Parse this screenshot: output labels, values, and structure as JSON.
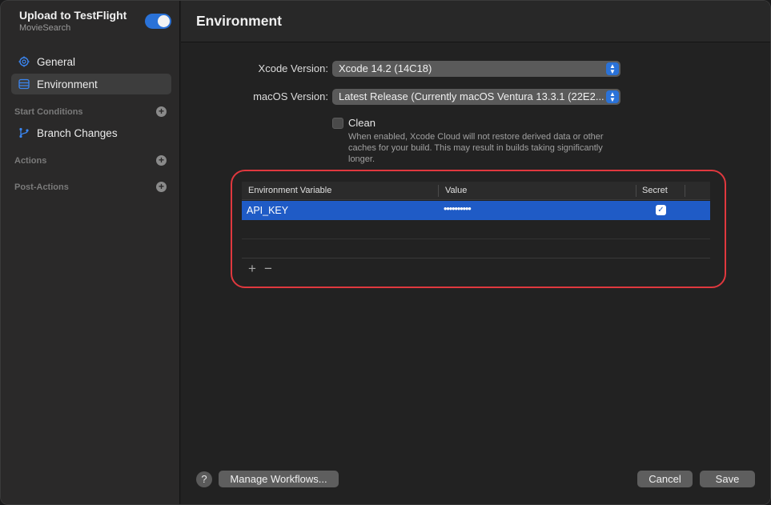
{
  "sidebar": {
    "workflow_title": "Upload to TestFlight",
    "workflow_subtitle": "MovieSearch",
    "toggle_on": true,
    "items": [
      {
        "label": "General",
        "icon": "gear-icon"
      },
      {
        "label": "Environment",
        "icon": "environment-icon",
        "selected": true
      }
    ],
    "start_conditions": {
      "title": "Start Conditions",
      "items": [
        {
          "label": "Branch Changes",
          "icon": "branch-icon"
        }
      ]
    },
    "actions": {
      "title": "Actions"
    },
    "post_actions": {
      "title": "Post-Actions"
    }
  },
  "main": {
    "title": "Environment",
    "xcode_version": {
      "label": "Xcode Version:",
      "value": "Xcode 14.2 (14C18)"
    },
    "macos_version": {
      "label": "macOS Version:",
      "value": "Latest Release (Currently macOS Ventura 13.3.1 (22E2..."
    },
    "clean": {
      "label": "Clean",
      "checked": false,
      "help": "When enabled, Xcode Cloud will not restore derived data or other caches for your build. This may result in builds taking significantly longer."
    },
    "env_table": {
      "columns": [
        "Environment Variable",
        "Value",
        "Secret"
      ],
      "rows": [
        {
          "name": "API_KEY",
          "value": "••••••••••",
          "secret": true
        }
      ],
      "add_label": "+",
      "remove_label": "−"
    }
  },
  "footer": {
    "help_label": "?",
    "manage_workflows": "Manage Workflows...",
    "cancel": "Cancel",
    "save": "Save"
  },
  "colors": {
    "accent": "#2a72d8",
    "selection": "#1f5bc6",
    "highlight_outline": "#e0383e"
  }
}
